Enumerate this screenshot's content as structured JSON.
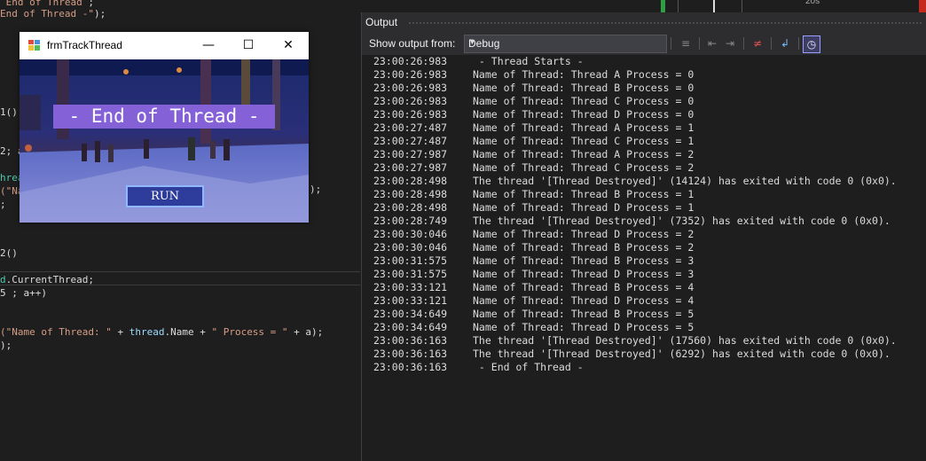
{
  "editor": {
    "lines": [
      {
        "parts": [
          {
            "t": " End of Thread ",
            "c": "str"
          },
          {
            "t": ";",
            "c": "plain"
          }
        ]
      },
      {
        "parts": [
          {
            "t": "End of Thread -\"",
            "c": "str"
          },
          {
            "t": ");",
            "c": "plain"
          }
        ]
      },
      {
        "parts": [
          {
            "t": "1()",
            "c": "plain"
          }
        ]
      },
      {
        "parts": [
          {
            "t": "2; a",
            "c": "plain"
          }
        ]
      },
      {
        "parts": [
          {
            "t": "hrea",
            "c": "type"
          }
        ]
      },
      {
        "parts": [
          {
            "t": "(\"Na",
            "c": "str"
          }
        ]
      },
      {
        "parts": [
          {
            "t": ";",
            "c": "plain"
          }
        ]
      },
      {
        "parts": [
          {
            "t": "2()",
            "c": "plain"
          }
        ]
      },
      {
        "parts": [
          {
            "t": "d",
            "c": "type"
          },
          {
            "t": ".CurrentThread;",
            "c": "plain"
          }
        ]
      },
      {
        "parts": [
          {
            "t": "5 ; a++)",
            "c": "plain"
          }
        ]
      },
      {
        "parts": [
          {
            "t": "(\"Name of Thread: \"",
            "c": "str"
          },
          {
            "t": " + ",
            "c": "plain"
          },
          {
            "t": "thread",
            "c": "var"
          },
          {
            "t": ".Name + ",
            "c": "plain"
          },
          {
            "t": "\" Process = \"",
            "c": "str"
          },
          {
            "t": " + a);",
            "c": "plain"
          }
        ]
      },
      {
        "parts": [
          {
            "t": ");",
            "c": "plain"
          }
        ]
      }
    ],
    "overflow_text": ");"
  },
  "topstrip": {
    "label": "20s"
  },
  "output": {
    "title": "Output",
    "show_from_label": "Show output from:",
    "source_selected": "Debug",
    "lines": [
      {
        "ts": "23:00:26:983",
        "msg": " - Thread Starts -"
      },
      {
        "ts": "23:00:26:983",
        "msg": "Name of Thread: Thread A Process = 0"
      },
      {
        "ts": "23:00:26:983",
        "msg": "Name of Thread: Thread B Process = 0"
      },
      {
        "ts": "23:00:26:983",
        "msg": "Name of Thread: Thread C Process = 0"
      },
      {
        "ts": "23:00:26:983",
        "msg": "Name of Thread: Thread D Process = 0"
      },
      {
        "ts": "23:00:27:487",
        "msg": "Name of Thread: Thread A Process = 1"
      },
      {
        "ts": "23:00:27:487",
        "msg": "Name of Thread: Thread C Process = 1"
      },
      {
        "ts": "23:00:27:987",
        "msg": "Name of Thread: Thread A Process = 2"
      },
      {
        "ts": "23:00:27:987",
        "msg": "Name of Thread: Thread C Process = 2"
      },
      {
        "ts": "23:00:28:498",
        "msg": "The thread '[Thread Destroyed]' (14124) has exited with code 0 (0x0)."
      },
      {
        "ts": "23:00:28:498",
        "msg": "Name of Thread: Thread B Process = 1"
      },
      {
        "ts": "23:00:28:498",
        "msg": "Name of Thread: Thread D Process = 1"
      },
      {
        "ts": "23:00:28:749",
        "msg": "The thread '[Thread Destroyed]' (7352) has exited with code 0 (0x0)."
      },
      {
        "ts": "23:00:30:046",
        "msg": "Name of Thread: Thread D Process = 2"
      },
      {
        "ts": "23:00:30:046",
        "msg": "Name of Thread: Thread B Process = 2"
      },
      {
        "ts": "23:00:31:575",
        "msg": "Name of Thread: Thread B Process = 3"
      },
      {
        "ts": "23:00:31:575",
        "msg": "Name of Thread: Thread D Process = 3"
      },
      {
        "ts": "23:00:33:121",
        "msg": "Name of Thread: Thread B Process = 4"
      },
      {
        "ts": "23:00:33:121",
        "msg": "Name of Thread: Thread D Process = 4"
      },
      {
        "ts": "23:00:34:649",
        "msg": "Name of Thread: Thread B Process = 5"
      },
      {
        "ts": "23:00:34:649",
        "msg": "Name of Thread: Thread D Process = 5"
      },
      {
        "ts": "23:00:36:163",
        "msg": "The thread '[Thread Destroyed]' (17560) has exited with code 0 (0x0)."
      },
      {
        "ts": "23:00:36:163",
        "msg": "The thread '[Thread Destroyed]' (6292) has exited with code 0 (0x0)."
      },
      {
        "ts": "23:00:36:163",
        "msg": " - End of Thread -"
      }
    ]
  },
  "form": {
    "title": "frmTrackThread",
    "banner_text": "- End of Thread -",
    "run_label": "RUN",
    "minimize_glyph": "—",
    "maximize_glyph": "☐",
    "close_glyph": "✕"
  },
  "colors": {
    "banner_bg": "#8561d8",
    "run_bg": "#2e3c9c",
    "accent_active": "#9aa0ff"
  }
}
